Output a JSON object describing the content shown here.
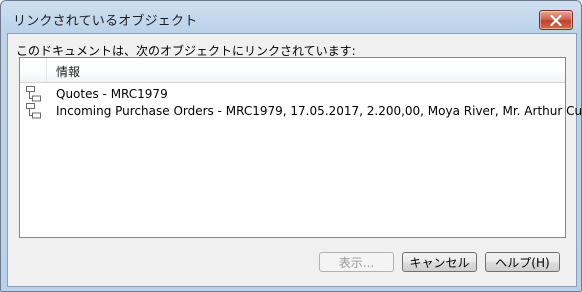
{
  "window": {
    "title": "リンクされているオブジェクト"
  },
  "prompt": "このドキュメントは、次のオブジェクトにリンクされています:",
  "list": {
    "column_header": "情報",
    "rows": [
      {
        "text": "Quotes - MRC1979",
        "icon": "tree-node-icon"
      },
      {
        "text": "Incoming Purchase Orders - MRC1979, 17.05.2017, 2.200,00, Moya River, Mr. Arthur Cutsworth",
        "icon": "tree-node-icon"
      }
    ]
  },
  "buttons": {
    "show_label": "表示...",
    "cancel_label": "キャンセル",
    "help_label": "ヘルプ(H)"
  },
  "colors": {
    "close_button": "#c0432b",
    "frame": "#b9d1ea",
    "client_bg": "#f0f0f0"
  }
}
